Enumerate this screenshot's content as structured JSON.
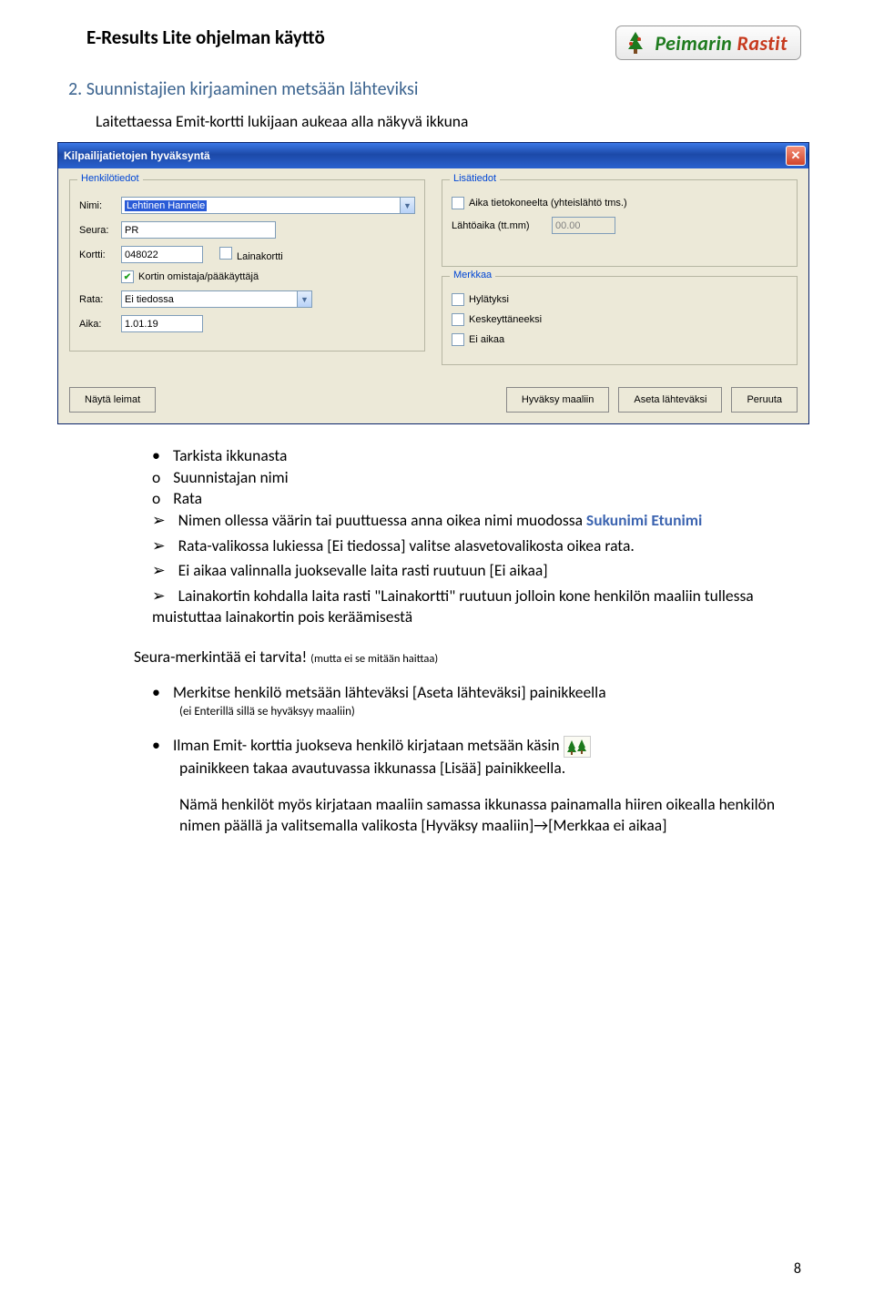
{
  "header": {
    "title": "E-Results Lite ohjelman käyttö"
  },
  "badge": {
    "green": "Peimarin",
    "red": " Rastit"
  },
  "h2": "2.  Suunnistajien kirjaaminen metsään lähteviksi",
  "intro": "Laitettaessa Emit-kortti lukijaan aukeaa alla näkyvä ikkuna",
  "win": {
    "title": "Kilpailijatietojen hyväksyntä",
    "fs1": "Henkilötiedot",
    "fs2": "Lisätiedot",
    "fs3": "Merkkaa",
    "labels": {
      "nimi": "Nimi:",
      "seura": "Seura:",
      "kortti": "Kortti:",
      "rata": "Rata:",
      "aika": "Aika:",
      "lahtoaika": "Lähtöaika (tt.mm)"
    },
    "vals": {
      "nimi": "Lehtinen Hannele",
      "seura": "PR",
      "kortti": "048022",
      "rata": "Ei tiedossa",
      "aika": "1.01.19",
      "lahtoaika": "00.00"
    },
    "chk": {
      "laina": "Lainakortti",
      "omistaja": "Kortin omistaja/pääkäyttäjä",
      "aikatk": "Aika tietokoneelta (yhteislähtö tms.)",
      "hylatyksi": "Hylätyksi",
      "keskeyt": "Keskeyttäneeksi",
      "eiaikaa": "Ei aikaa"
    },
    "btn": {
      "leimat": "Näytä leimat",
      "hyvaksy": "Hyväksy maaliin",
      "aseta": "Aseta lähteväksi",
      "peruuta": "Peruuta"
    }
  },
  "bul": {
    "l1": "Tarkista ikkunasta",
    "l2a": "Suunnistajan nimi",
    "l2b": "Rata",
    "l3a_1": "Nimen ollessa väärin tai puuttuessa anna oikea nimi muodossa ",
    "l3a_2": "Sukunimi Etunimi",
    "l3b": "Rata-valikossa lukiessa [Ei tiedossa] valitse alasvetovalikosta oikea rata.",
    "l3c": "Ei aikaa valinnalla juoksevalle laita rasti ruutuun [Ei aikaa]",
    "l3d": "Lainakortin kohdalla laita rasti \"Lainakortti\" ruutuun jolloin kone henkilön maaliin tullessa muistuttaa lainakortin pois keräämisestä"
  },
  "seura": {
    "a": "Seura-merkintää ei tarvita! ",
    "b": "(mutta ei se mitään haittaa)"
  },
  "blk1": {
    "a": "Merkitse henkilö metsään lähteväksi [Aseta lähteväksi] painikkeella",
    "b": "(ei Enterillä sillä se hyväksyy maaliin)"
  },
  "blk2": {
    "a": "Ilman Emit- korttia juokseva henkilö kirjataan metsään käsin ",
    "b": "painikkeen takaa avautuvassa ikkunassa [Lisää] painikkeella."
  },
  "blk3": "Nämä henkilöt myös kirjataan maaliin samassa ikkunassa painamalla hiiren oikealla henkilön nimen päällä ja valitsemalla valikosta [Hyväksy maaliin]→[Merkkaa ei aikaa]",
  "page_num": "8"
}
